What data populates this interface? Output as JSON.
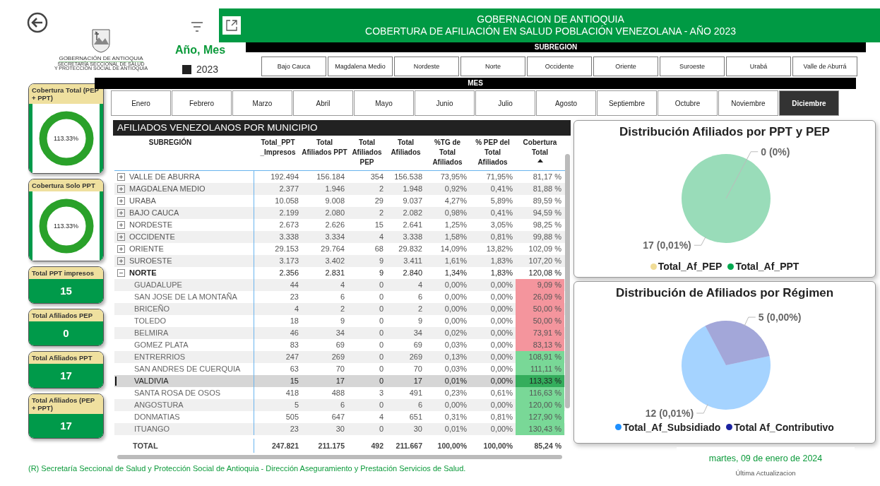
{
  "logo": {
    "title": "GOBERNACIÓN DE ANTIOQUIA",
    "subtitle_lines": [
      "SECRETARÍA SECCIONAL DE SALUD",
      "Y PROTECCIÓN SOCIAL DE ANTIOQUIA"
    ]
  },
  "year_slicer": {
    "title": "Año, Mes",
    "items": [
      {
        "label": "2023",
        "checked": true
      }
    ]
  },
  "banner": {
    "lines": [
      "GOBERNACION DE ANTIOQUIA",
      "COBERTURA DE AFILIACIÓN EN SALUD POBLACIÓN VENEZOLANA - AÑO 2023"
    ]
  },
  "subregion_slicer": {
    "title": "SUBREGION",
    "items": [
      {
        "label": "Bajo Cauca",
        "selected": false
      },
      {
        "label": "Magdalena Medio",
        "selected": false
      },
      {
        "label": "Nordeste",
        "selected": false
      },
      {
        "label": "Norte",
        "selected": false
      },
      {
        "label": "Occidente",
        "selected": false
      },
      {
        "label": "Oriente",
        "selected": false
      },
      {
        "label": "Suroeste",
        "selected": false
      },
      {
        "label": "Urabá",
        "selected": false
      },
      {
        "label": "Valle de Aburrá",
        "selected": false
      }
    ]
  },
  "month_slicer": {
    "title": "MES",
    "items": [
      {
        "label": "Enero",
        "selected": false
      },
      {
        "label": "Febrero",
        "selected": false
      },
      {
        "label": "Marzo",
        "selected": false
      },
      {
        "label": "Abril",
        "selected": false
      },
      {
        "label": "Mayo",
        "selected": false
      },
      {
        "label": "Junio",
        "selected": false
      },
      {
        "label": "Julio",
        "selected": false
      },
      {
        "label": "Agosto",
        "selected": false
      },
      {
        "label": "Septiembre",
        "selected": false
      },
      {
        "label": "Octubre",
        "selected": false
      },
      {
        "label": "Noviembre",
        "selected": false
      },
      {
        "label": "Diciembre",
        "selected": true
      }
    ]
  },
  "kpi_cards": [
    {
      "kind": "donut",
      "title": "Cobertura Total (PEP + PPT)",
      "value": "113.33%"
    },
    {
      "kind": "donut",
      "title": "Cobertura Solo PPT",
      "value": "113.33%"
    },
    {
      "kind": "value",
      "title": "Total PPT impresos",
      "value": "15"
    },
    {
      "kind": "value",
      "title": "Total Afiliados PEP",
      "value": "0"
    },
    {
      "kind": "value",
      "title": "Total Afiliados PPT",
      "value": "17"
    },
    {
      "kind": "value",
      "title": "Total Afiliados (PEP + PPT)",
      "value": "17"
    }
  ],
  "table": {
    "title": "AFILIADOS VENEZOLANOS POR MUNICIPIO",
    "columns": [
      {
        "label": "SUBREGIÓN",
        "sorted": false
      },
      {
        "label": "Total_PPT _Impresos",
        "sorted": false
      },
      {
        "label": "Total Afiliados PPT",
        "sorted": false
      },
      {
        "label": "Total Afiliados PEP",
        "sorted": false
      },
      {
        "label": "Total Afiliados",
        "sorted": false
      },
      {
        "label": "%TG de Total Afiliados",
        "sorted": false
      },
      {
        "label": "% PEP del Total Afiliados",
        "sorted": false
      },
      {
        "label": "Cobertura Total",
        "sorted": true
      }
    ],
    "rows": [
      {
        "name": "VALLE DE ABURRA",
        "values": [
          "192.494",
          "156.184",
          "354",
          "156.538",
          "73,95%",
          "71,95%",
          "81,17 %"
        ],
        "expanded": false
      },
      {
        "name": "MAGDALENA MEDIO",
        "values": [
          "2.377",
          "1.946",
          "2",
          "1.948",
          "0,92%",
          "0,41%",
          "81,88 %"
        ],
        "expanded": false
      },
      {
        "name": "URABA",
        "values": [
          "10.058",
          "9.008",
          "29",
          "9.037",
          "4,27%",
          "5,89%",
          "89,59 %"
        ],
        "expanded": false
      },
      {
        "name": "BAJO CAUCA",
        "values": [
          "2.199",
          "2.080",
          "2",
          "2.082",
          "0,98%",
          "0,41%",
          "94,59 %"
        ],
        "expanded": false
      },
      {
        "name": "NORDESTE",
        "values": [
          "2.673",
          "2.626",
          "15",
          "2.641",
          "1,25%",
          "3,05%",
          "98,25 %"
        ],
        "expanded": false
      },
      {
        "name": "OCCIDENTE",
        "values": [
          "3.338",
          "3.334",
          "4",
          "3.338",
          "1,58%",
          "0,81%",
          "99,88 %"
        ],
        "expanded": false
      },
      {
        "name": "ORIENTE",
        "values": [
          "29.153",
          "29.764",
          "68",
          "29.832",
          "14,09%",
          "13,82%",
          "102,09 %"
        ],
        "expanded": false
      },
      {
        "name": "SUROESTE",
        "values": [
          "3.173",
          "3.402",
          "9",
          "3.411",
          "1,61%",
          "1,83%",
          "107,20 %"
        ],
        "expanded": false
      },
      {
        "name": "NORTE",
        "values": [
          "2.356",
          "2.831",
          "9",
          "2.840",
          "1,34%",
          "1,83%",
          "120,08 %"
        ],
        "expanded": true,
        "children": [
          {
            "name": "GUADALUPE",
            "values": [
              "44",
              "4",
              "0",
              "4",
              "0,00%",
              "0,00%",
              "9,09 %"
            ],
            "color": "#f4959d",
            "selected": false
          },
          {
            "name": "SAN JOSE DE LA MONTAÑA",
            "values": [
              "23",
              "6",
              "0",
              "6",
              "0,00%",
              "0,00%",
              "26,09 %"
            ],
            "color": "#f4959d",
            "selected": false
          },
          {
            "name": "BRICEÑO",
            "values": [
              "4",
              "2",
              "0",
              "2",
              "0,00%",
              "0,00%",
              "50,00 %"
            ],
            "color": "#f4959d",
            "selected": false
          },
          {
            "name": "TOLEDO",
            "values": [
              "18",
              "9",
              "0",
              "9",
              "0,00%",
              "0,00%",
              "50,00 %"
            ],
            "color": "#f4959d",
            "selected": false
          },
          {
            "name": "BELMIRA",
            "values": [
              "46",
              "34",
              "0",
              "34",
              "0,02%",
              "0,00%",
              "73,91 %"
            ],
            "color": "#f4959d",
            "selected": false
          },
          {
            "name": "GOMEZ PLATA",
            "values": [
              "83",
              "69",
              "0",
              "69",
              "0,03%",
              "0,00%",
              "83,13 %"
            ],
            "color": "#f4959d",
            "selected": false
          },
          {
            "name": "ENTRERRIOS",
            "values": [
              "247",
              "269",
              "0",
              "269",
              "0,13%",
              "0,00%",
              "108,91 %"
            ],
            "color": "#79d897",
            "selected": false
          },
          {
            "name": "SAN ANDRES DE CUERQUIA",
            "values": [
              "63",
              "70",
              "0",
              "70",
              "0,03%",
              "0,00%",
              "111,11 %"
            ],
            "color": "#79d897",
            "selected": false
          },
          {
            "name": "VALDIVIA",
            "values": [
              "15",
              "17",
              "0",
              "17",
              "0,01%",
              "0,00%",
              "113,33 %"
            ],
            "color": "#34ad5c",
            "selected": true
          },
          {
            "name": "SANTA ROSA DE OSOS",
            "values": [
              "418",
              "488",
              "3",
              "491",
              "0,23%",
              "0,61%",
              "116,63 %"
            ],
            "color": "#79d897",
            "selected": false
          },
          {
            "name": "ANGOSTURA",
            "values": [
              "5",
              "6",
              "0",
              "6",
              "0,00%",
              "0,00%",
              "120,00 %"
            ],
            "color": "#79d897",
            "selected": false
          },
          {
            "name": "DONMATIAS",
            "values": [
              "505",
              "647",
              "4",
              "651",
              "0,31%",
              "0,81%",
              "127,90 %"
            ],
            "color": "#79d897",
            "selected": false
          },
          {
            "name": "ITUANGO",
            "values": [
              "23",
              "30",
              "0",
              "30",
              "0,01%",
              "0,00%",
              "130,43 %"
            ],
            "color": "#79d897",
            "selected": false
          }
        ]
      }
    ],
    "total": {
      "name": "TOTAL",
      "values": [
        "247.821",
        "211.175",
        "492",
        "211.667",
        "100,00%",
        "100,00%",
        "85,24 %"
      ]
    }
  },
  "charts": [
    {
      "chart_data": {
        "type": "pie",
        "title": "Distribución Afiliados por PPT y PEP",
        "categories": [
          "Total_Af_PEP",
          "Total_Af_PPT"
        ],
        "values": [
          0,
          17
        ],
        "colors": [
          "#f0dc96",
          "#00a84f"
        ],
        "value_labels": [
          "0 (0%)",
          "17 (0,01%)"
        ]
      }
    },
    {
      "chart_data": {
        "type": "pie",
        "title": "Distribución de Afiliados por Régimen",
        "categories": [
          "Total_Af_Subsidiado",
          "Total Af_Contributivo"
        ],
        "values": [
          12,
          5
        ],
        "colors": [
          "#1e90ff",
          "#1a22a0"
        ],
        "value_labels": [
          "12 (0,01%)",
          "5 (0,00%)"
        ]
      }
    }
  ],
  "last_update": {
    "date": "martes, 09 de enero de 2024",
    "label": "Última Actualizacion"
  },
  "footer": "(R) Secretaría Seccional de Salud y Protección Social de Antioquia - Dirección Aseguramiento y Prestación Servicios de Salud."
}
